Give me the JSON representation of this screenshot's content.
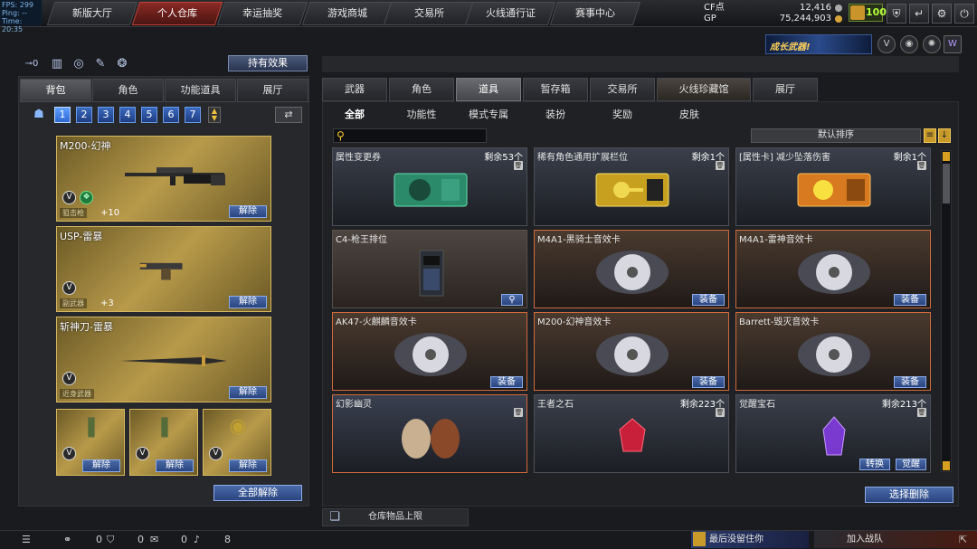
{
  "perf": {
    "fps_label": "FPS: 299",
    "ping_label": "Ping: --",
    "time_label": "Time: 20:35"
  },
  "nav": {
    "tabs": [
      "新版大厅",
      "个人仓库",
      "幸运抽奖",
      "游戏商城",
      "交易所",
      "火线通行证",
      "赛事中心"
    ],
    "active_index": 1
  },
  "currency": {
    "cf_label": "CF点",
    "cf_value": "12,416",
    "gp_label": "GP",
    "gp_value": "75,244,903"
  },
  "level": "100",
  "promo": {
    "banner_text": "成长武器!"
  },
  "left": {
    "hold_effect_label": "持有效果",
    "tabs": [
      "背包",
      "角色",
      "功能道具",
      "展厅"
    ],
    "active_tab": 0,
    "pages": [
      "1",
      "2",
      "3",
      "4",
      "5",
      "6",
      "7"
    ],
    "active_page": 0,
    "slots": [
      {
        "name": "M200-幻神",
        "type": "狙击枪",
        "extra": "+10",
        "button": "解除"
      },
      {
        "name": "USP-雷暴",
        "type": "副武器",
        "extra": "+3",
        "button": "解除"
      },
      {
        "name": "斩神刀-雷暴",
        "type": "近身武器",
        "extra": "",
        "button": "解除"
      }
    ],
    "grenades": [
      {
        "button": "解除"
      },
      {
        "button": "解除"
      },
      {
        "button": "解除"
      }
    ],
    "unequip_all_label": "全部解除"
  },
  "right": {
    "tabs": [
      "武器",
      "角色",
      "道具",
      "暂存箱",
      "交易所",
      "火线珍藏馆",
      "展厅"
    ],
    "active_tab": 2,
    "subtabs": [
      "全部",
      "功能性",
      "模式专属",
      "装扮",
      "奖励",
      "皮肤"
    ],
    "active_subtab": 0,
    "search_placeholder": "",
    "sort_label": "默认排序",
    "cards": [
      {
        "name": "属性变更券",
        "remain": "剩余53个",
        "button": "",
        "style": "blue",
        "art": "ticket-green"
      },
      {
        "name": "稀有角色通用扩展栏位",
        "remain": "剩余1个",
        "button": "",
        "style": "blue",
        "art": "ticket-gold"
      },
      {
        "name": "[属性卡] 减少坠落伤害",
        "remain": "剩余1个",
        "button": "",
        "style": "blue",
        "art": "ticket-orange"
      },
      {
        "name": "C4-枪王排位",
        "remain": "",
        "button": "🔍",
        "style": "red",
        "art": "c4"
      },
      {
        "name": "M4A1-黑骑士音效卡",
        "remain": "",
        "button": "装备",
        "style": "orange",
        "art": "disc"
      },
      {
        "name": "M4A1-雷神音效卡",
        "remain": "",
        "button": "装备",
        "style": "orange",
        "art": "disc"
      },
      {
        "name": "AK47-火麒麟音效卡",
        "remain": "",
        "button": "装备",
        "style": "orange",
        "art": "disc"
      },
      {
        "name": "M200-幻神音效卡",
        "remain": "",
        "button": "装备",
        "style": "orange",
        "art": "disc"
      },
      {
        "name": "Barrett-毁灭音效卡",
        "remain": "",
        "button": "装备",
        "style": "orange",
        "art": "disc"
      },
      {
        "name": "幻影幽灵",
        "remain": "",
        "button": "",
        "style": "orange-dark",
        "art": "masks"
      },
      {
        "name": "王者之石",
        "remain": "剩余223个",
        "button": "",
        "style": "blue",
        "art": "gem-red"
      },
      {
        "name": "觉醒宝石",
        "remain": "剩余213个",
        "button": "",
        "style": "blue",
        "art": "gem-purple"
      }
    ],
    "gem_buttons": [
      "转换",
      "觉醒"
    ],
    "batch_delete_label": "选择删除",
    "capacity_label": "仓库物品上限"
  },
  "bottom": {
    "counts": [
      "0",
      "0",
      "0",
      "8"
    ],
    "last_login_label": "最后没留住你",
    "join_team_label": "加入战队"
  }
}
